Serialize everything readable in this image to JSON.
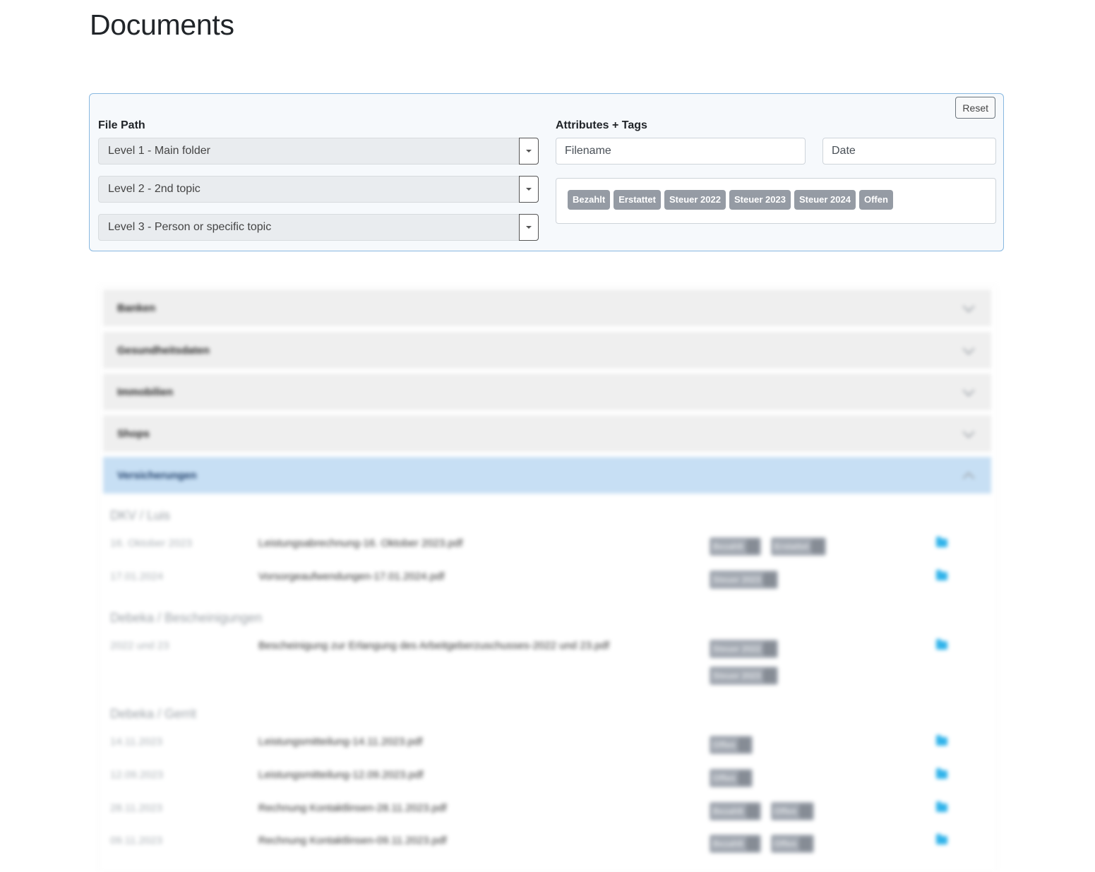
{
  "page": {
    "title": "Documents"
  },
  "filters": {
    "reset_label": "Reset",
    "file_path_label": "File Path",
    "levels": [
      "Level 1 - Main folder",
      "Level 2 - 2nd topic",
      "Level 3 - Person or specific topic"
    ],
    "attributes_label": "Attributes + Tags",
    "filename_placeholder": "Filename",
    "date_placeholder": "Date",
    "tags": [
      "Bezahlt",
      "Erstattet",
      "Steuer 2022",
      "Steuer 2023",
      "Steuer 2024",
      "Offen"
    ]
  },
  "accordion": {
    "sections": [
      {
        "title": "Banken",
        "expanded": false
      },
      {
        "title": "Gesundheitsdaten",
        "expanded": false
      },
      {
        "title": "Immobilien",
        "expanded": false
      },
      {
        "title": "Shops",
        "expanded": false
      },
      {
        "title": "Versicherungen",
        "expanded": true
      }
    ],
    "groups": [
      {
        "heading": "DKV / Luis",
        "files": [
          {
            "date": "16. Oktober 2023",
            "name": "Leistungsabrechnung-16. Oktober 2023.pdf",
            "tags": [
              "Bezahlt",
              "Erstattet"
            ]
          },
          {
            "date": "17.01.2024",
            "name": "Vorsorgeaufwendungen-17.01.2024.pdf",
            "tags": [
              "Steuer 2023"
            ]
          }
        ]
      },
      {
        "heading": "Debeka / Bescheinigungen",
        "files": [
          {
            "date": "2022 und 23",
            "name": "Bescheinigung zur Erlangung des Arbeitgeberzuschusses-2022 und 23.pdf",
            "tags": [
              "Steuer 2022",
              "Steuer 2023"
            ]
          }
        ]
      },
      {
        "heading": "Debeka / Gerrit",
        "files": [
          {
            "date": "14.11.2023",
            "name": "Leistungsmitteilung-14.11.2023.pdf",
            "tags": [
              "Offen"
            ]
          },
          {
            "date": "12.09.2023",
            "name": "Leistungsmitteilung-12.09.2023.pdf",
            "tags": [
              "Offen"
            ]
          },
          {
            "date": "28.11.2023",
            "name": "Rechnung Kontaktlinsen-28.11.2023.pdf",
            "tags": [
              "Bezahlt",
              "Offen"
            ]
          },
          {
            "date": "09.11.2023",
            "name": "Rechnung Kontaktlinsen-09.11.2023.pdf",
            "tags": [
              "Bezahlt",
              "Offen"
            ]
          }
        ]
      }
    ]
  },
  "colors": {
    "accent": "#88b8e0",
    "tag": "#959ba4",
    "active_section": "#c7dff4",
    "folder_icon": "#2fb3ea"
  }
}
